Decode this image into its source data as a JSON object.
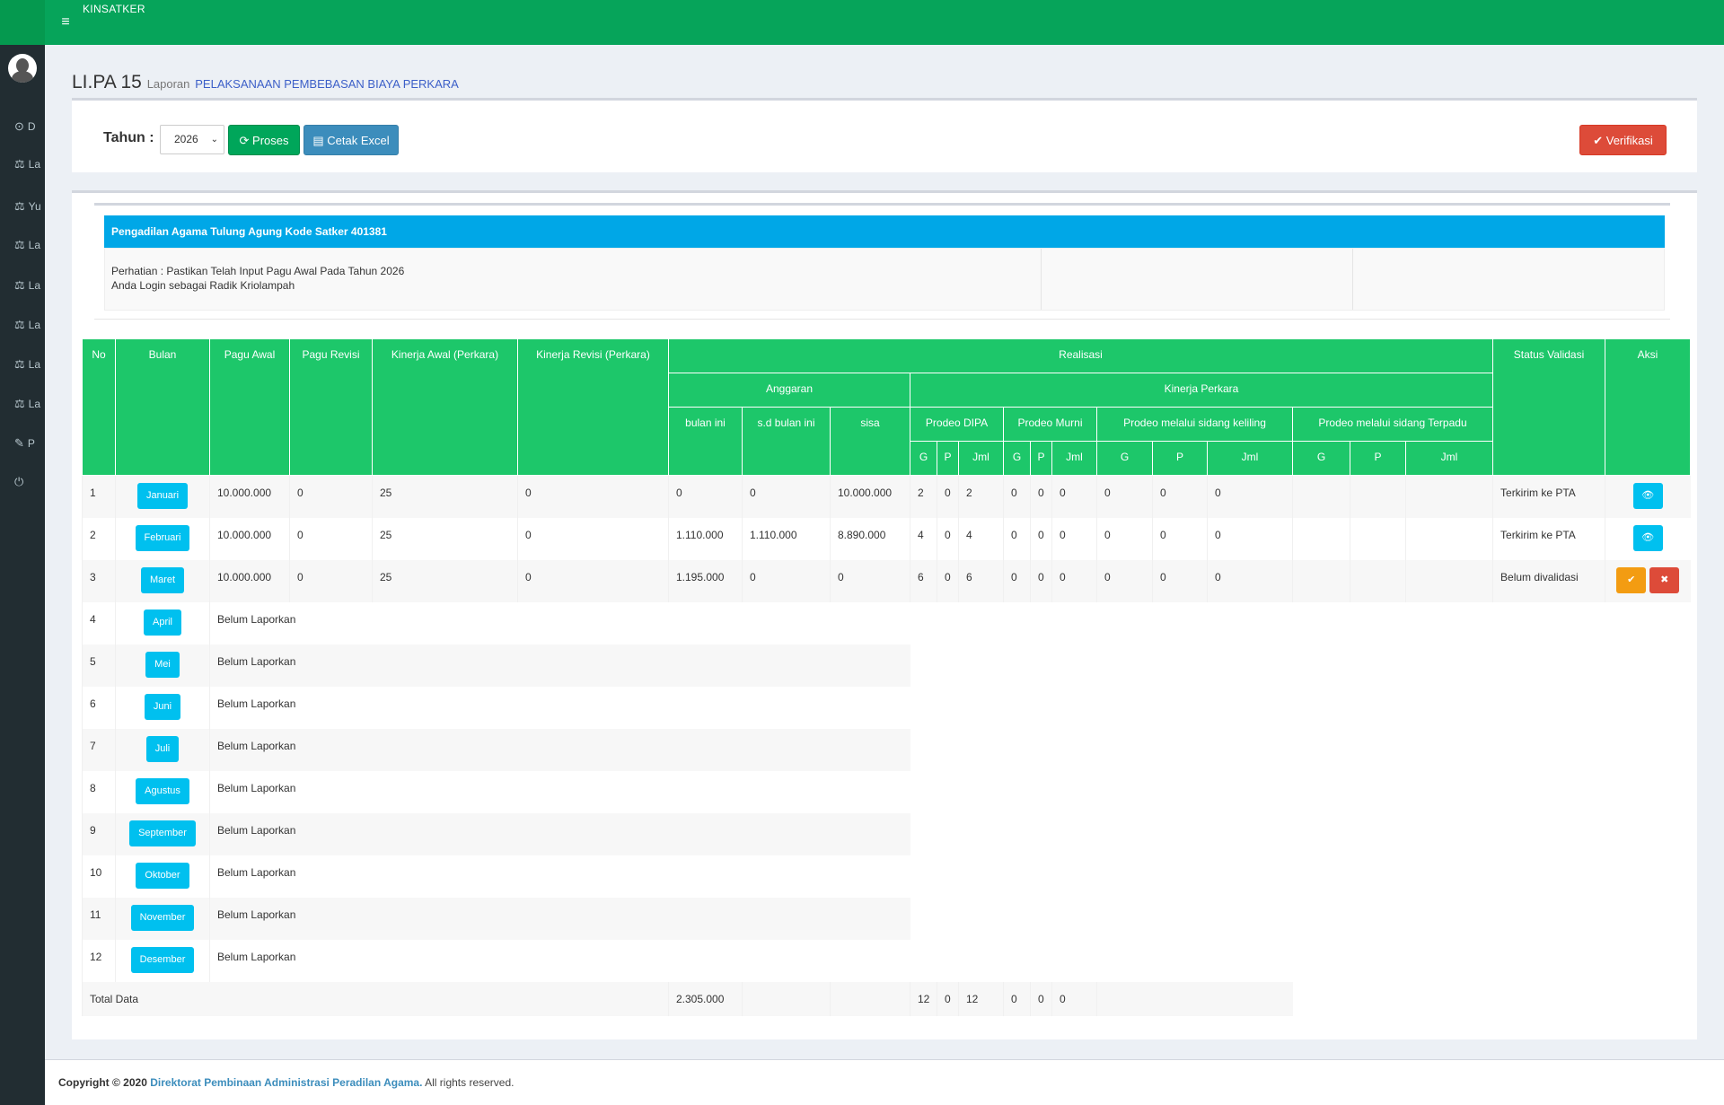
{
  "app": {
    "brand": "KINSATKER"
  },
  "sidebar": {
    "items": [
      {
        "icon": "dashboard-icon",
        "glyph": "⊙",
        "label": "D"
      },
      {
        "icon": "balance-icon",
        "glyph": "⚖",
        "label": "La"
      },
      {
        "icon": "balance-icon",
        "glyph": "⚖",
        "label": "Yu"
      },
      {
        "icon": "balance-icon",
        "glyph": "⚖",
        "label": "La"
      },
      {
        "icon": "balance-icon",
        "glyph": "⚖",
        "label": "La"
      },
      {
        "icon": "balance-icon",
        "glyph": "⚖",
        "label": "La"
      },
      {
        "icon": "balance-icon",
        "glyph": "⚖",
        "label": "La"
      },
      {
        "icon": "balance-icon",
        "glyph": "⚖",
        "label": "La"
      },
      {
        "icon": "edit-icon",
        "glyph": "✎",
        "label": "P"
      },
      {
        "icon": "power-icon",
        "glyph": "⏻",
        "label": ""
      }
    ]
  },
  "page": {
    "title": "LI.PA 15",
    "subtitle": "Laporan",
    "subtitle_link": "PELAKSANAAN PEMBEBASAN BIAYA PERKARA"
  },
  "toolbar": {
    "tahun_label": "Tahun :",
    "tahun_value": "2026",
    "proses_label": "Proses",
    "excel_label": "Cetak Excel",
    "verifikasi_label": "Verifikasi"
  },
  "info": {
    "header": "Pengadilan Agama Tulung Agung Kode Satker 401381",
    "line1": "Perhatian : Pastikan Telah Input Pagu Awal Pada Tahun 2026",
    "line2": "Anda Login sebagai Radik Kriolampah"
  },
  "table": {
    "headers": {
      "no": "No",
      "bulan": "Bulan",
      "pagu_awal": "Pagu Awal",
      "pagu_revisi": "Pagu Revisi",
      "kinerja_awal": "Kinerja Awal (Perkara)",
      "kinerja_revisi": "Kinerja Revisi (Perkara)",
      "realisasi": "Realisasi",
      "status": "Status Validasi",
      "aksi": "Aksi",
      "anggaran": "Anggaran",
      "kinerja_perkara": "Kinerja Perkara",
      "bulan_ini": "bulan ini",
      "sd_bulan_ini": "s.d bulan ini",
      "sisa": "sisa",
      "prodeo_dipa": "Prodeo DIPA",
      "prodeo_murni": "Prodeo Murni",
      "prodeo_keliling": "Prodeo melalui sidang keliling",
      "prodeo_terpadu": "Prodeo melalui sidang Terpadu",
      "g": "G",
      "p": "P",
      "jml": "Jml"
    },
    "reported": [
      {
        "no": "1",
        "bulan": "Januari",
        "pagu_awal": "10.000.000",
        "pagu_revisi": "0",
        "kinerja_awal": "25",
        "kinerja_revisi": "0",
        "bulan_ini": "0",
        "sd_bulan_ini": "0",
        "sisa": "10.000.000",
        "dipa_g": "2",
        "dipa_p": "0",
        "dipa_jml": "2",
        "murni_g": "0",
        "murni_p": "0",
        "murni_jml": "0",
        "kel_g": "0",
        "kel_p": "0",
        "kel_jml": "0",
        "status": "Terkirim ke PTA",
        "status_type": "ok"
      },
      {
        "no": "2",
        "bulan": "Februari",
        "pagu_awal": "10.000.000",
        "pagu_revisi": "0",
        "kinerja_awal": "25",
        "kinerja_revisi": "0",
        "bulan_ini": "1.110.000",
        "sd_bulan_ini": "1.110.000",
        "sisa": "8.890.000",
        "dipa_g": "4",
        "dipa_p": "0",
        "dipa_jml": "4",
        "murni_g": "0",
        "murni_p": "0",
        "murni_jml": "0",
        "kel_g": "0",
        "kel_p": "0",
        "kel_jml": "0",
        "status": "Terkirim ke PTA",
        "status_type": "ok"
      },
      {
        "no": "3",
        "bulan": "Maret",
        "pagu_awal": "10.000.000",
        "pagu_revisi": "0",
        "kinerja_awal": "25",
        "kinerja_revisi": "0",
        "bulan_ini": "1.195.000",
        "sd_bulan_ini": "0",
        "sisa": "0",
        "dipa_g": "6",
        "dipa_p": "0",
        "dipa_jml": "6",
        "murni_g": "0",
        "murni_p": "0",
        "murni_jml": "0",
        "kel_g": "0",
        "kel_p": "0",
        "kel_jml": "0",
        "status": "Belum divalidasi",
        "status_type": "pending"
      }
    ],
    "unreported_text": "Belum Laporkan",
    "unreported": [
      {
        "no": "4",
        "bulan": "April"
      },
      {
        "no": "5",
        "bulan": "Mei"
      },
      {
        "no": "6",
        "bulan": "Juni"
      },
      {
        "no": "7",
        "bulan": "Juli"
      },
      {
        "no": "8",
        "bulan": "Agustus"
      },
      {
        "no": "9",
        "bulan": "September"
      },
      {
        "no": "10",
        "bulan": "Oktober"
      },
      {
        "no": "11",
        "bulan": "November"
      },
      {
        "no": "12",
        "bulan": "Desember"
      }
    ],
    "total": {
      "label": "Total Data",
      "bulan_ini": "2.305.000",
      "dipa_g": "12",
      "dipa_p": "0",
      "dipa_jml": "12",
      "murni_g": "0",
      "murni_p": "0",
      "murni_jml": "0"
    }
  },
  "footer": {
    "prefix": "Copyright © 2020",
    "link": "Direktorat Pembinaan Administrasi Peradilan Agama.",
    "suffix": "All rights reserved."
  },
  "colors": {
    "topbar": "#06a45a",
    "sidebar": "#222d32",
    "header_green": "#1dc76a",
    "info_blue": "#00a7e7",
    "month_btn": "#00c0ef",
    "danger": "#dd4b39",
    "warning": "#f39c12"
  }
}
